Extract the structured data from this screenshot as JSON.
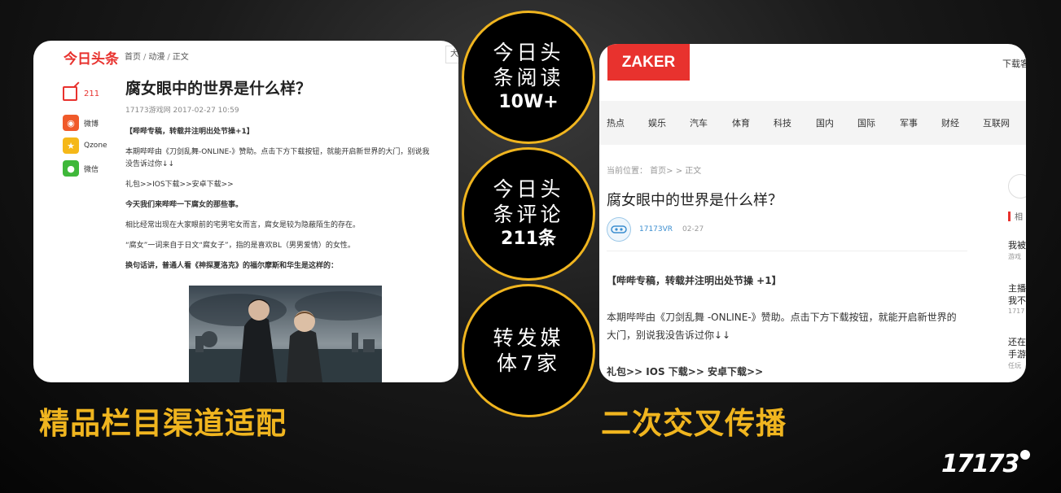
{
  "left_panel": {
    "logo": "今日头条",
    "breadcrumb": [
      "首页",
      "动漫",
      "正文"
    ],
    "big_btn": "大",
    "comment_count": "211",
    "share": [
      {
        "label": "微博",
        "icon": "weibo-icon"
      },
      {
        "label": "Qzone",
        "icon": "qzone-icon"
      },
      {
        "label": "微信",
        "icon": "wechat-icon"
      }
    ],
    "title": "腐女眼中的世界是什么样？",
    "meta": "17173游戏网  2017-02-27 10:59",
    "paragraphs": [
      {
        "text": "【哔哔专稿，转载井注明出处节操+1】",
        "bold": true
      },
      {
        "text": "本期哔哔由《刀剑乱舞-ONLINE-》赞助。点击下方下载按钮，就能开启新世界的大门，别说我没告诉过你↓↓",
        "bold": false
      },
      {
        "text": "礼包>>IOS下载>>安卓下载>>",
        "bold": false
      },
      {
        "text": "今天我们来哔哔一下腐女的那些事。",
        "bold": true
      },
      {
        "text": "相比经常出现在大家眼前的宅男宅女而言，腐女是较为隐蔽陌生的存在。",
        "bold": false
      },
      {
        "text": "“腐女”一词来自于日文“腐女子”，指的是喜欢BL（男男爱情）的女性。",
        "bold": false
      },
      {
        "text": "换句话讲，普通人看《神探夏洛克》的福尔摩斯和华生是这样的：",
        "bold": true
      }
    ]
  },
  "right_panel": {
    "logo": "ZAKER",
    "download": "下载客",
    "nav": [
      "热点",
      "娱乐",
      "汽车",
      "体育",
      "科技",
      "国内",
      "国际",
      "军事",
      "财经",
      "互联网"
    ],
    "breadcrumb": "当前位置： 首页> > 正文",
    "title": "腐女眼中的世界是什么样？",
    "author": "17173VR",
    "date": "02-27",
    "p1": "【哔哔专稿，转载并注明出处节操 +1】",
    "p2": "本期哔哔由《刀剑乱舞 -ONLINE-》赞助。点击下方下载按钮，就能开启新世界的大门，别说我没告诉过你↓↓",
    "p3": "礼包>> IOS 下载>> 安卓下载>>",
    "side": {
      "heading": "相",
      "items": [
        {
          "title": "我被",
          "sub": "游戏"
        },
        {
          "title": "主播",
          "title2": "我不",
          "sub": "1717"
        },
        {
          "title": "还在",
          "title2": "手游",
          "sub": "任玩"
        }
      ]
    }
  },
  "stats": [
    {
      "line1": "今日头",
      "line2": "条阅读",
      "value": "10W+"
    },
    {
      "line1": "今日头",
      "line2": "条评论",
      "value": "211条"
    },
    {
      "line1": "转发媒",
      "line2": "体7家",
      "value": ""
    }
  ],
  "captions": {
    "left": "精品栏目渠道适配",
    "right": "二次交叉传播"
  },
  "brand": "17173",
  "colors": {
    "accent": "#f0b51f",
    "red": "#e8322e"
  }
}
